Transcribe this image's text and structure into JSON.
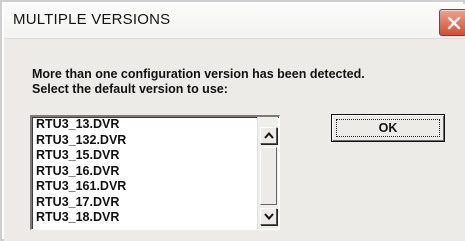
{
  "window": {
    "title": "MULTIPLE VERSIONS",
    "close_icon": "close-icon",
    "close_color": "#d84b30"
  },
  "message": {
    "line1": "More than one configuration version has been detected.",
    "line2": "Select the default version to use:"
  },
  "version_list": {
    "items": [
      "RTU3_13.DVR",
      "RTU3_132.DVR",
      "RTU3_15.DVR",
      "RTU3_16.DVR",
      "RTU3_161.DVR",
      "RTU3_17.DVR",
      "RTU3_18.DVR"
    ],
    "scroll_up_icon": "chevron-up-icon",
    "scroll_down_icon": "chevron-down-icon"
  },
  "buttons": {
    "ok_label": "OK"
  }
}
